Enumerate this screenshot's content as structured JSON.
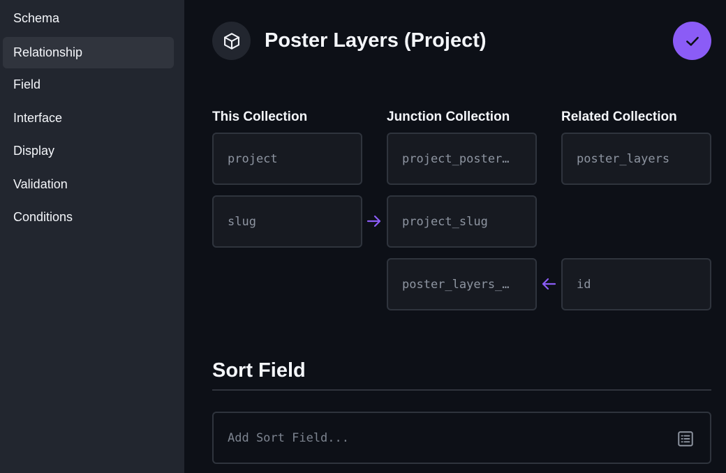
{
  "sidebar": {
    "items": [
      {
        "label": "Schema"
      },
      {
        "label": "Relationship",
        "active": true
      },
      {
        "label": "Field"
      },
      {
        "label": "Interface"
      },
      {
        "label": "Display"
      },
      {
        "label": "Validation"
      },
      {
        "label": "Conditions"
      }
    ]
  },
  "header": {
    "icon": "box-icon",
    "title": "Poster Layers (Project)",
    "save_icon": "check-icon"
  },
  "relationship": {
    "columns": {
      "this": "This Collection",
      "junction": "Junction Collection",
      "related": "Related Collection"
    },
    "this_collection": "project",
    "this_field": "slug",
    "junction_collection": "project_poster…",
    "junction_field_this": "project_slug",
    "junction_field_related": "poster_layers_…",
    "related_collection": "poster_layers",
    "related_field": "id"
  },
  "sort_field": {
    "title": "Sort Field",
    "placeholder": "Add Sort Field...",
    "icon": "list-icon"
  },
  "colors": {
    "accent": "#8b5cf6",
    "sidebar_bg": "#22262f",
    "main_bg": "#0d1017"
  }
}
